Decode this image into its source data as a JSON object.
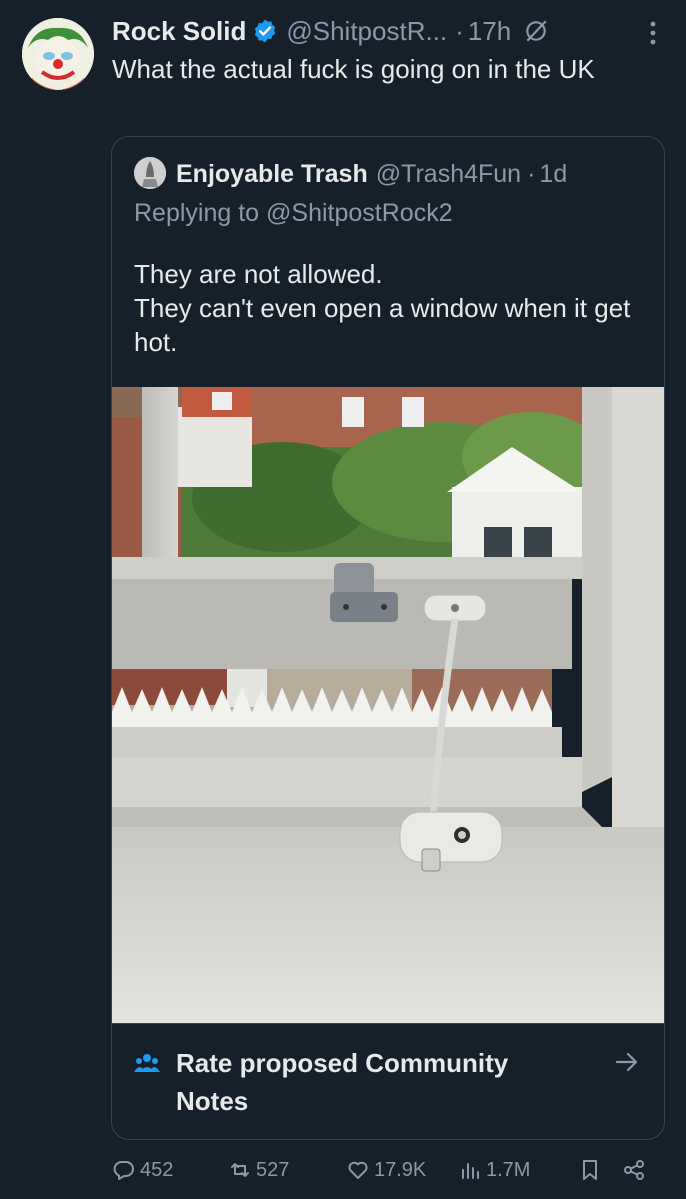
{
  "tweet": {
    "author_name": "Rock Solid",
    "handle": "@ShitpostR...",
    "separator": "·",
    "time": "17h",
    "text": "What the actual fuck is going on in the UK"
  },
  "quote": {
    "author_name": "Enjoyable Trash",
    "handle": "@Trash4Fun",
    "separator": "·",
    "time": "1d",
    "replying_label": "Replying to",
    "replying_handle": "@ShitpostRock2",
    "text": "They are not allowed.\nThey can't even open a window when it get hot.",
    "photo_icon": "window-photo"
  },
  "community_notes": {
    "label": "Rate proposed Community Notes",
    "icon": "people-icon",
    "accent": "#1d9bf0"
  },
  "actions": {
    "replies": "452",
    "reposts": "527",
    "likes": "17.9K",
    "views": "1.7M"
  },
  "colors": {
    "background": "#15202b",
    "text": "#e7e9ea",
    "muted": "#8b98a5",
    "verified": "#1d9bf0",
    "border": "#38444d"
  }
}
